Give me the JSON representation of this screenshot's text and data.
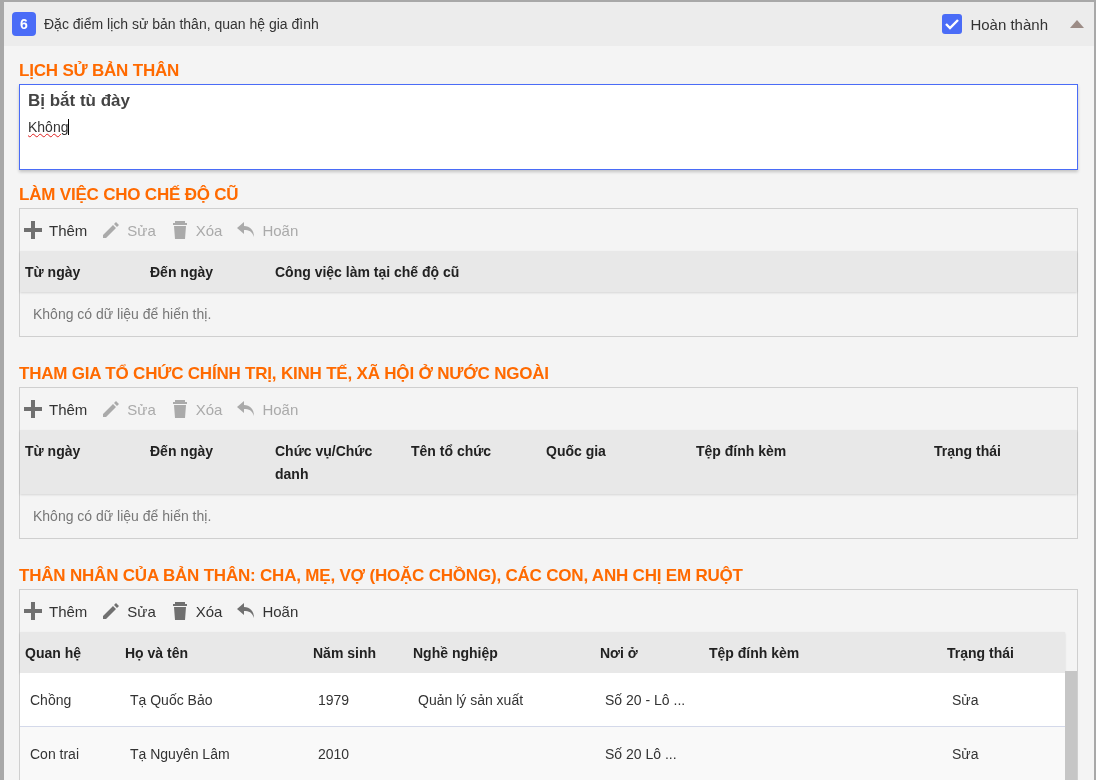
{
  "header": {
    "number": "6",
    "title": "Đặc điểm lịch sử bản thân, quan hệ gia đình",
    "complete": {
      "label": "Hoàn thành",
      "checked": true
    },
    "expanded": true
  },
  "history": {
    "heading": "LỊCH SỬ BẢN THÂN",
    "label": "Bị bắt tù đày",
    "value": "Không"
  },
  "grids": [
    {
      "heading": "LÀM VIỆC CHO CHẾ ĐỘ CŨ",
      "toolbar": [
        {
          "kind": "add",
          "label": "Thêm",
          "disabled": false
        },
        {
          "kind": "edit",
          "label": "Sửa",
          "disabled": true
        },
        {
          "kind": "delete",
          "label": "Xóa",
          "disabled": true
        },
        {
          "kind": "undo",
          "label": "Hoãn",
          "disabled": true
        }
      ],
      "columns": [
        "Từ ngày",
        "Đến ngày",
        "Công việc làm tại chế độ cũ"
      ],
      "empty_text": "Không có dữ liệu để hiển thị."
    },
    {
      "heading": "THAM GIA TỔ CHỨC CHÍNH TRỊ, KINH TẾ, XÃ HỘI Ở NƯỚC NGOÀI",
      "toolbar": [
        {
          "kind": "add",
          "label": "Thêm",
          "disabled": false
        },
        {
          "kind": "edit",
          "label": "Sửa",
          "disabled": true
        },
        {
          "kind": "delete",
          "label": "Xóa",
          "disabled": true
        },
        {
          "kind": "undo",
          "label": "Hoãn",
          "disabled": true
        }
      ],
      "columns": [
        "Từ ngày",
        "Đến ngày",
        "Chức vụ/Chức danh",
        "Tên tổ chức",
        "Quốc gia",
        "Tệp đính kèm",
        "Trạng thái"
      ],
      "empty_text": "Không có dữ liệu để hiển thị."
    },
    {
      "heading": "THÂN NHÂN CỦA BẢN THÂN: CHA, MẸ, VỢ (HOẶC CHỒNG), CÁC CON, ANH CHỊ EM RUỘT",
      "toolbar": [
        {
          "kind": "add",
          "label": "Thêm",
          "disabled": false
        },
        {
          "kind": "edit",
          "label": "Sửa",
          "disabled": false
        },
        {
          "kind": "delete",
          "label": "Xóa",
          "disabled": false
        },
        {
          "kind": "undo",
          "label": "Hoãn",
          "disabled": false
        }
      ],
      "columns": [
        "Quan hệ",
        "Họ và tên",
        "Năm sinh",
        "Nghề nghiệp",
        "Nơi ở",
        "Tệp đính kèm",
        "Trạng thái"
      ],
      "rows": [
        [
          "Chồng",
          "Tạ Quốc Bảo",
          "1979",
          "Quản lý sản xuất",
          "Số 20 - Lô ...",
          "",
          "Sửa"
        ],
        [
          "Con trai",
          "Tạ Nguyên Lâm",
          "2010",
          "",
          "Số 20 Lô ...",
          "",
          "Sửa"
        ]
      ]
    }
  ]
}
